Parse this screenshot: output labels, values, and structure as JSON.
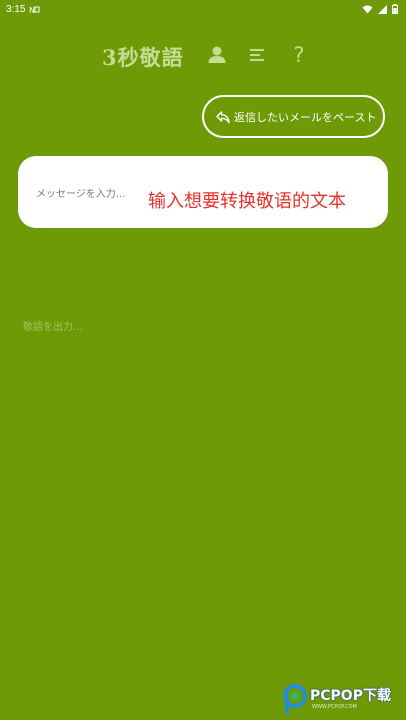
{
  "status_bar": {
    "time": "3:15",
    "icons": [
      "notification-icon",
      "wifi-icon",
      "signal-icon",
      "battery-icon"
    ]
  },
  "header": {
    "title": "3秒敬語",
    "icons": [
      "profile-icon",
      "menu-icon",
      "help-icon"
    ],
    "help_symbol": "?"
  },
  "paste_button": {
    "label": "返信したいメールをペースト",
    "icon": "reply-arrow-icon"
  },
  "input": {
    "placeholder": "メッセージを入力...",
    "annotation": "输入想要转换敬语的文本"
  },
  "output": {
    "placeholder": "敬語を出力…"
  },
  "watermark": {
    "text": "PCPOP下载",
    "subtext": "WWW.PCPOP.COM"
  },
  "colors": {
    "background": "#6f9a08",
    "title": "#c5dc93",
    "card": "#ffffff",
    "annotation": "#e8302c"
  }
}
